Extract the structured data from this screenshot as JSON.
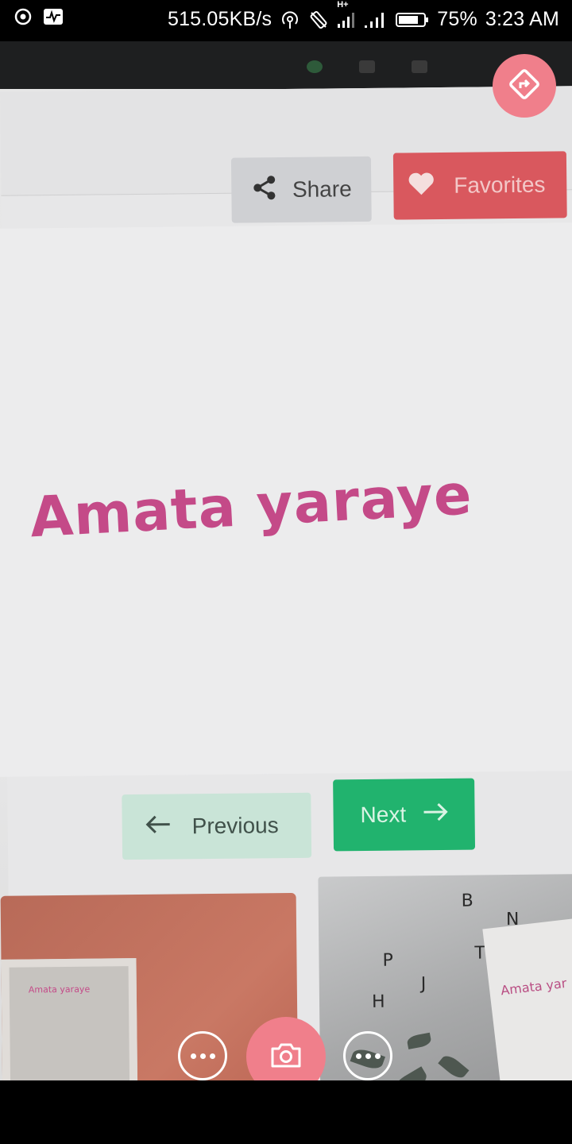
{
  "status_bar": {
    "network_speed": "515.05KB/s",
    "network_type": "H+",
    "battery": "75%",
    "time": "3:23 AM",
    "icons": [
      "record-icon",
      "activity-icon",
      "hotspot-icon",
      "auto-rotate-icon",
      "signal-icon",
      "signal-icon",
      "battery-icon"
    ]
  },
  "screen": {
    "share_label": "Share",
    "favorites_label": "Favorites",
    "title": "Amata yaraye",
    "previous_label": "Previous",
    "next_label": "Next",
    "thumb1_text": "Amata yaraye",
    "thumb2_text": "Amata yar",
    "thumb2_letters": [
      "B",
      "N",
      "T",
      "H",
      "J",
      "P"
    ]
  },
  "colors": {
    "title": "#c44a88",
    "favorites": "#d9585e",
    "next": "#21b36e",
    "previous": "#c9e4d7",
    "camera_accent": "#f07f8b"
  },
  "camera_controls": {
    "left_more_icon": "more-icon",
    "shutter_icon": "camera-icon",
    "right_more_icon": "more-icon",
    "direction_icon": "directions-icon"
  }
}
